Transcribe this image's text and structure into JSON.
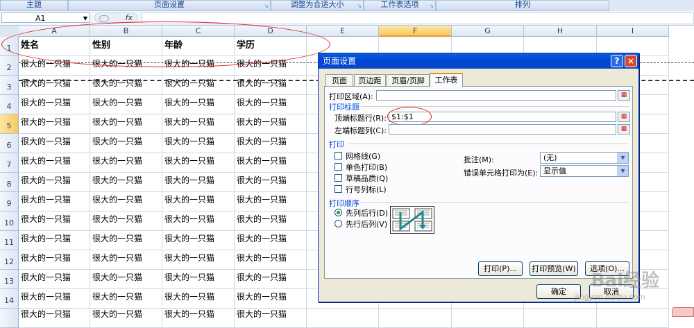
{
  "ribbon": {
    "groups": [
      "主题",
      "页面设置",
      "调整为合适大小",
      "工作表选项",
      "排列"
    ]
  },
  "formula_bar": {
    "cell_ref": "A1",
    "fx": "fx",
    "value": ""
  },
  "columns": [
    "A",
    "B",
    "C",
    "D",
    "E",
    "F",
    "G",
    "H",
    "I"
  ],
  "rows": [
    "1",
    "2",
    "3",
    "4",
    "5",
    "6",
    "7",
    "8",
    "9",
    "10",
    "11",
    "12",
    "13",
    "14"
  ],
  "header_row": [
    "姓名",
    "性别",
    "年龄",
    "学历"
  ],
  "cell_text": "很大的一只猫",
  "cut_row_text": "很大的一只猫",
  "dialog": {
    "title": "页面设置",
    "help": "?",
    "close": "×",
    "tabs": [
      "页面",
      "页边距",
      "页眉/页脚",
      "工作表"
    ],
    "print_area_label": "打印区域(A):",
    "print_titles_section": "打印标题",
    "rows_repeat_label": "顶端标题行(R):",
    "rows_repeat_value": "$1:$1",
    "cols_repeat_label": "左端标题列(C):",
    "cols_repeat_value": "",
    "print_section": "打印",
    "options": [
      "网格线(G)",
      "单色打印(B)",
      "草稿品质(Q)",
      "行号列标(L)"
    ],
    "comments_label": "批注(M):",
    "comments_value": "(无)",
    "errors_label": "错误单元格打印为(E):",
    "errors_value": "显示值",
    "order_section": "打印顺序",
    "order_options": [
      "先列后行(D)",
      "先行后列(V)"
    ],
    "print_btn": "打印(P)...",
    "preview_btn": "打印预览(W)",
    "options_btn": "选项(O)...",
    "ok_btn": "确定",
    "cancel_btn": "取消"
  },
  "watermark": {
    "main": "Bai经验",
    "sub": "jingyan.baidu.com"
  },
  "colors": {
    "title_bar": "#0046d5",
    "annotation": "#d22222",
    "selected_header": "#f8c85e"
  }
}
